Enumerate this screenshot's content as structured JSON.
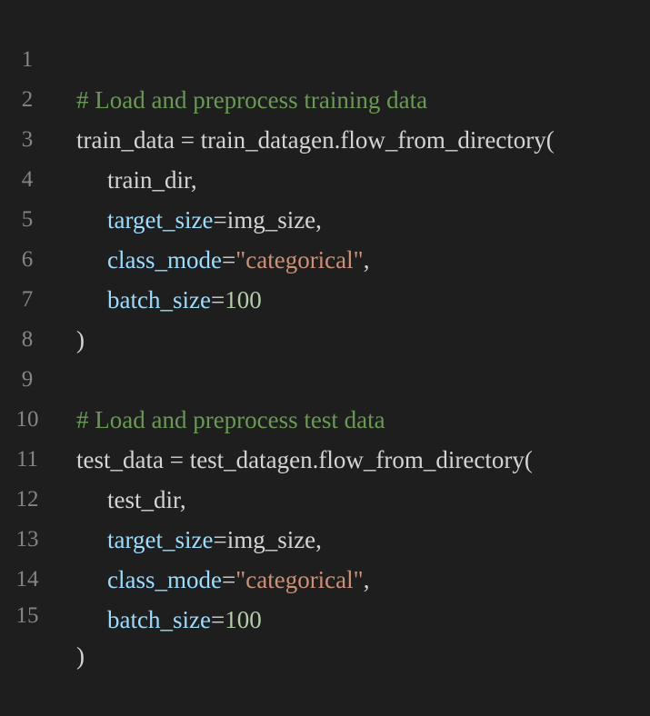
{
  "colors": {
    "background": "#1e1e1e",
    "line_number": "#858585",
    "comment": "#6a9955",
    "identifier": "#d4d4d4",
    "parameter": "#9cdcfe",
    "string": "#ce9178",
    "number": "#b5cea8"
  },
  "lines": [
    {
      "number": "1",
      "tokens": [
        {
          "t": "comment",
          "v": "# Load and preprocess training data"
        }
      ]
    },
    {
      "number": "2",
      "tokens": [
        {
          "t": "ident",
          "v": "train_data = train_datagen.flow_from_directory("
        }
      ]
    },
    {
      "number": "3",
      "tokens": [
        {
          "t": "ident",
          "v": "train_dir,"
        }
      ]
    },
    {
      "number": "4",
      "tokens": [
        {
          "t": "param",
          "v": "target_size"
        },
        {
          "t": "op",
          "v": "="
        },
        {
          "t": "ident",
          "v": "img_size,"
        }
      ]
    },
    {
      "number": "5",
      "tokens": [
        {
          "t": "param",
          "v": "class_mode"
        },
        {
          "t": "op",
          "v": "="
        },
        {
          "t": "string",
          "v": "\"categorical\""
        },
        {
          "t": "punct",
          "v": ","
        }
      ]
    },
    {
      "number": "6",
      "tokens": [
        {
          "t": "param",
          "v": "batch_size"
        },
        {
          "t": "op",
          "v": "="
        },
        {
          "t": "number",
          "v": "100"
        }
      ]
    },
    {
      "number": "7",
      "tokens": [
        {
          "t": "punct",
          "v": ")"
        }
      ]
    },
    {
      "number": "8",
      "tokens": []
    },
    {
      "number": "9",
      "tokens": [
        {
          "t": "comment",
          "v": "# Load and preprocess test data"
        }
      ]
    },
    {
      "number": "10",
      "tokens": [
        {
          "t": "ident",
          "v": "test_data = test_datagen.flow_from_directory("
        }
      ]
    },
    {
      "number": "11",
      "tokens": [
        {
          "t": "ident",
          "v": "test_dir,"
        }
      ]
    },
    {
      "number": "12",
      "tokens": [
        {
          "t": "param",
          "v": "target_size"
        },
        {
          "t": "op",
          "v": "="
        },
        {
          "t": "ident",
          "v": "img_size,"
        }
      ]
    },
    {
      "number": "13",
      "tokens": [
        {
          "t": "param",
          "v": "class_mode"
        },
        {
          "t": "op",
          "v": "="
        },
        {
          "t": "string",
          "v": "\"categorical\""
        },
        {
          "t": "punct",
          "v": ","
        }
      ]
    },
    {
      "number": "14",
      "tokens": [
        {
          "t": "param",
          "v": "batch_size"
        },
        {
          "t": "op",
          "v": "="
        },
        {
          "t": "number",
          "v": "100"
        }
      ]
    },
    {
      "number": "15",
      "tokens": [
        {
          "t": "punct",
          "v": ")"
        }
      ]
    }
  ]
}
